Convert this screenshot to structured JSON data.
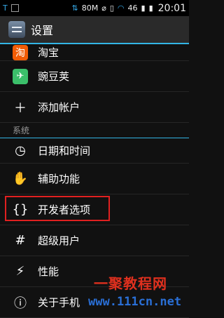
{
  "statusbar": {
    "speed": "80M",
    "network": "46",
    "time": "20:01"
  },
  "actionbar": {
    "title": "设置"
  },
  "items_top": [
    {
      "label": "淘宝",
      "icon": "taobao-icon"
    },
    {
      "label": "豌豆荚",
      "icon": "wandoujia-icon"
    },
    {
      "label": "添加帐户",
      "icon": "add-icon"
    }
  ],
  "section_system": "系统",
  "items_system": [
    {
      "label": "日期和时间",
      "icon": "clock-icon"
    },
    {
      "label": "辅助功能",
      "icon": "hand-icon"
    },
    {
      "label": "开发者选项",
      "icon": "braces-icon"
    },
    {
      "label": "超级用户",
      "icon": "hash-icon"
    },
    {
      "label": "性能",
      "icon": "bolt-icon"
    },
    {
      "label": "关于手机",
      "icon": "info-icon"
    }
  ],
  "watermark": {
    "title": "一聚教程网",
    "url": "www.111cn.net"
  },
  "colors": {
    "accent": "#33b5e5",
    "highlight": "#e02020"
  }
}
